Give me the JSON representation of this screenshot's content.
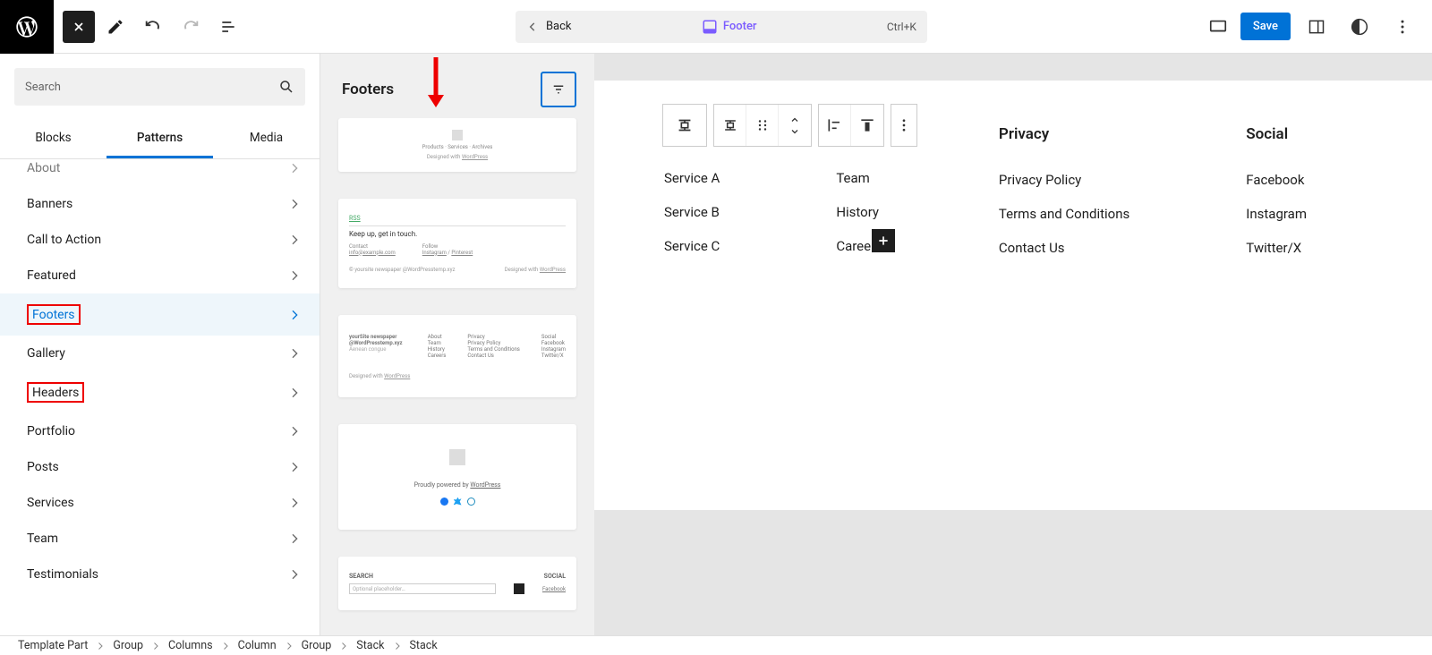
{
  "topbar": {
    "back_label": "Back",
    "doc_label": "Footer",
    "shortcut": "Ctrl+K",
    "save_label": "Save"
  },
  "sidebar": {
    "search_placeholder": "Search",
    "tabs": {
      "blocks": "Blocks",
      "patterns": "Patterns",
      "media": "Media"
    },
    "categories": [
      {
        "label": "About",
        "selected": false
      },
      {
        "label": "Banners",
        "selected": false
      },
      {
        "label": "Call to Action",
        "selected": false
      },
      {
        "label": "Featured",
        "selected": false
      },
      {
        "label": "Footers",
        "selected": true,
        "red": true
      },
      {
        "label": "Gallery",
        "selected": false
      },
      {
        "label": "Headers",
        "selected": false,
        "red": true
      },
      {
        "label": "Portfolio",
        "selected": false
      },
      {
        "label": "Posts",
        "selected": false
      },
      {
        "label": "Services",
        "selected": false
      },
      {
        "label": "Team",
        "selected": false
      },
      {
        "label": "Testimonials",
        "selected": false
      }
    ]
  },
  "pattern_panel": {
    "title": "Footers"
  },
  "canvas": {
    "columns": [
      {
        "heading": "",
        "items": [
          "Service A",
          "Service B",
          "Service C"
        ],
        "hide_heading": true
      },
      {
        "heading": "",
        "items": [
          "Team",
          "History",
          "Careers"
        ],
        "hide_heading": true
      },
      {
        "heading": "Privacy",
        "items": [
          "Privacy Policy",
          "Terms and Conditions",
          "Contact Us"
        ]
      },
      {
        "heading": "Social",
        "items": [
          "Facebook",
          "Instagram",
          "Twitter/X"
        ]
      }
    ]
  },
  "breadcrumb": [
    "Template Part",
    "Group",
    "Columns",
    "Column",
    "Group",
    "Stack",
    "Stack"
  ]
}
